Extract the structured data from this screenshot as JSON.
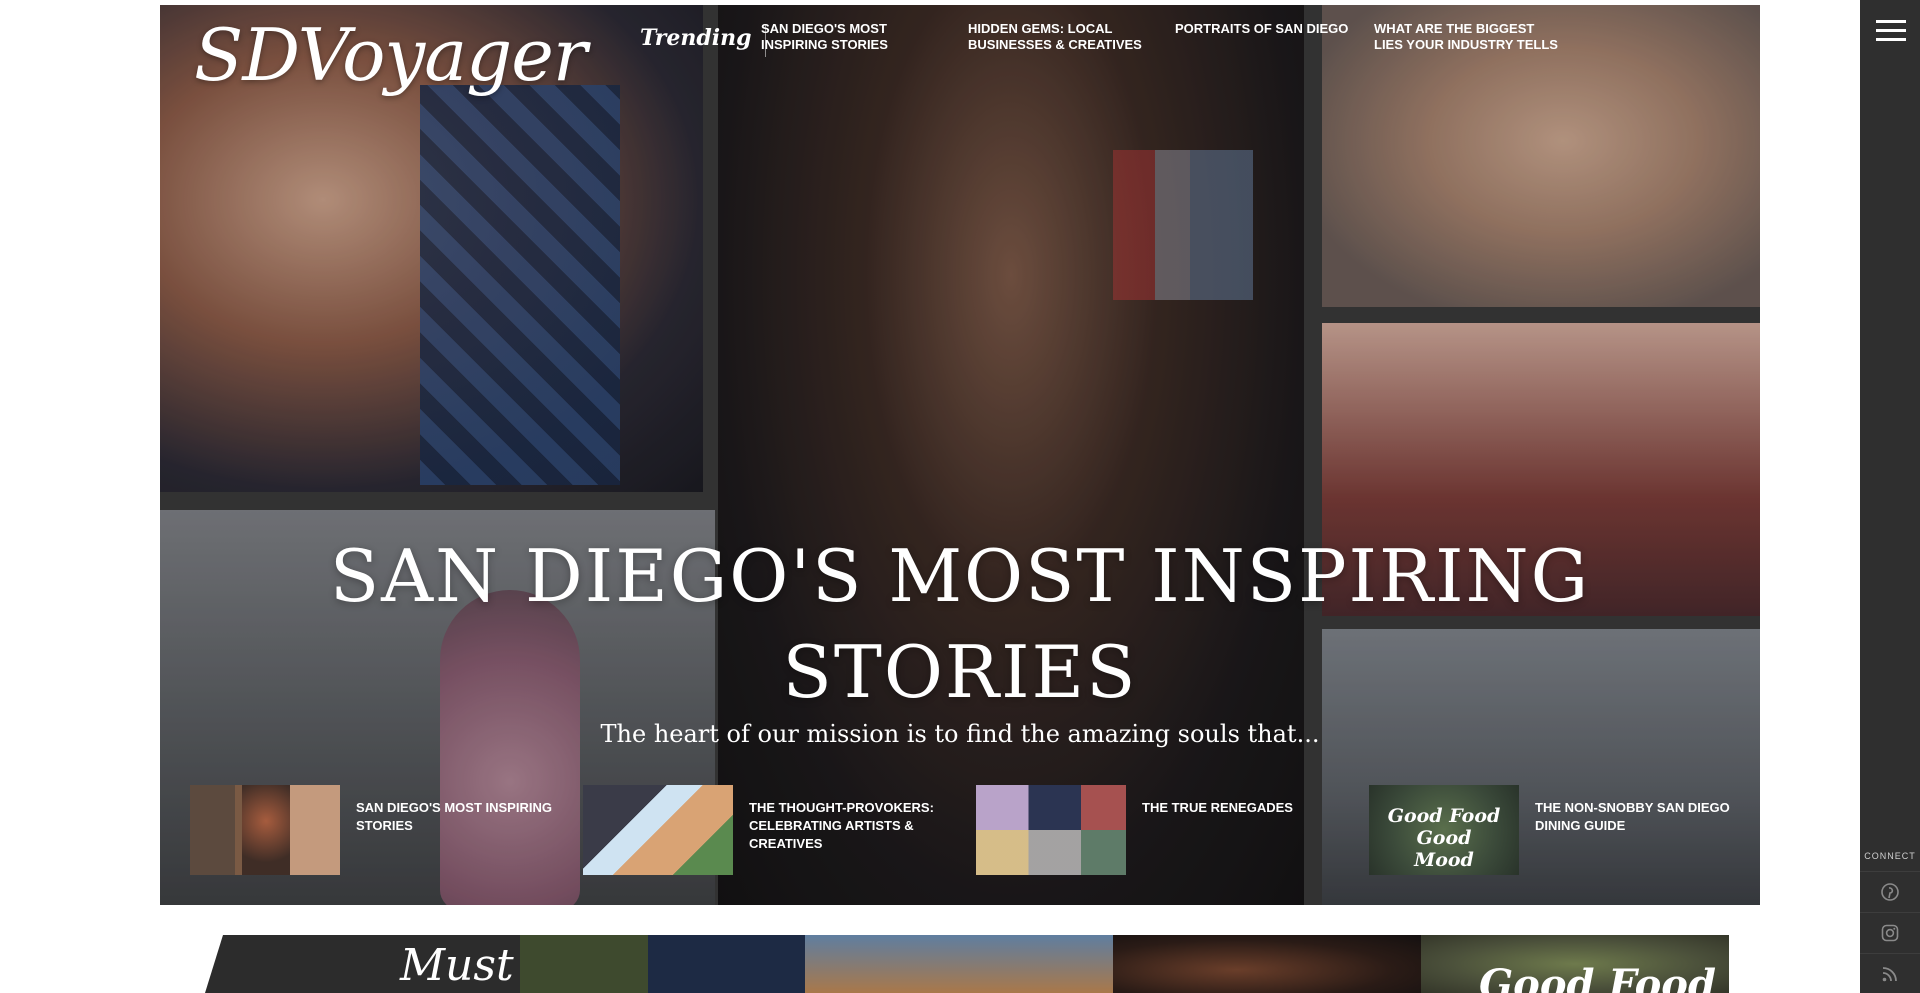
{
  "header": {
    "logo": "SDVoyager",
    "trending_label": "Trending",
    "trending_links": [
      {
        "line1": "SAN DIEGO'S MOST",
        "line2": "INSPIRING STORIES"
      },
      {
        "line1": "HIDDEN GEMS: LOCAL",
        "line2": "BUSINESSES & CREATIVES"
      },
      {
        "line1": "PORTRAITS OF SAN DIEGO",
        "line2": ""
      },
      {
        "line1": "WHAT ARE THE BIGGEST",
        "line2": "LIES YOUR INDUSTRY TELLS"
      }
    ]
  },
  "hero": {
    "title_line1": "SAN DIEGO'S MOST INSPIRING",
    "title_line2": "STORIES",
    "subtitle": "The heart of our mission is to find the amazing souls that..."
  },
  "stories": [
    {
      "title": "SAN DIEGO'S MOST INSPIRING STORIES"
    },
    {
      "title": "THE THOUGHT-PROVOKERS: CELEBRATING ARTISTS & CREATIVES"
    },
    {
      "title": "THE TRUE RENEGADES"
    },
    {
      "title": "THE NON-SNOBBY SAN DIEGO DINING GUIDE",
      "badge": "Good Food Good Mood"
    }
  ],
  "sidebar": {
    "connect_label": "CONNECT",
    "social_icons": [
      "pinterest-icon",
      "instagram-icon",
      "rss-icon"
    ]
  },
  "must_section": {
    "heading": "Must",
    "badge_partial": "Good Food"
  }
}
